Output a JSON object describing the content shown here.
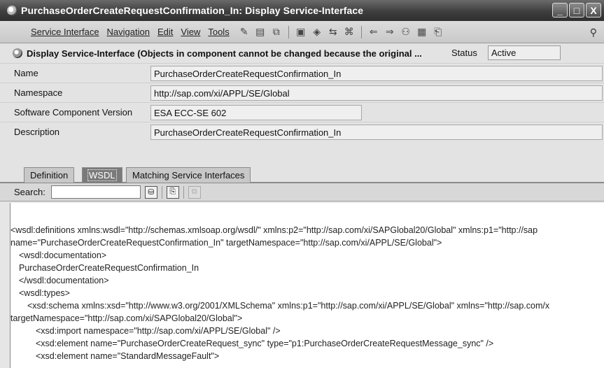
{
  "window": {
    "title": "PurchaseOrderCreateRequestConfirmation_In: Display Service-Interface",
    "minimize_label": "_",
    "maximize_label": "□",
    "close_label": "X"
  },
  "menu": [
    "Service Interface",
    "Navigation",
    "Edit",
    "View",
    "Tools"
  ],
  "toolbar_icons": {
    "group1": [
      "✎",
      "▤",
      "⧉"
    ],
    "group2": [
      "▣",
      "◈",
      "⇆",
      "⌘"
    ],
    "group3": [
      "⇐",
      "⇒",
      "⚇",
      "▦",
      "⎗"
    ],
    "pin": "⚲"
  },
  "header": {
    "title": "Display Service-Interface (Objects in component cannot be changed because the original ...",
    "status_label": "Status",
    "status_value": "Active"
  },
  "fields": [
    {
      "label": "Name",
      "value": "PurchaseOrderCreateRequestConfirmation_In"
    },
    {
      "label": "Namespace",
      "value": "http://sap.com/xi/APPL/SE/Global"
    },
    {
      "label": "Software Component Version",
      "value": "ESA ECC-SE 602"
    },
    {
      "label": "Description",
      "value": "PurchaseOrderCreateRequestConfirmation_In"
    }
  ],
  "tabs": [
    "Definition",
    "WSDL",
    "Matching Service Interfaces"
  ],
  "search": {
    "label": "Search:",
    "value": "",
    "btn_find": "⛁",
    "btn_next": "⎘",
    "btn_copy": "⧉"
  },
  "wsdl_lines": [
    "<wsdl:definitions xmlns:wsdl=\"http://schemas.xmlsoap.org/wsdl/\" xmlns:p2=\"http://sap.com/xi/SAPGlobal20/Global\" xmlns:p1=\"http://sap",
    "name=\"PurchaseOrderCreateRequestConfirmation_In\" targetNamespace=\"http://sap.com/xi/APPL/SE/Global\">",
    "<wsdl:documentation>",
    "PurchaseOrderCreateRequestConfirmation_In",
    "</wsdl:documentation>",
    "<wsdl:types>",
    "<xsd:schema xmlns:xsd=\"http://www.w3.org/2001/XMLSchema\" xmlns:p1=\"http://sap.com/xi/APPL/SE/Global\" xmlns=\"http://sap.com/x",
    "targetNamespace=\"http://sap.com/xi/SAPGlobal20/Global\">",
    "<xsd:import namespace=\"http://sap.com/xi/APPL/SE/Global\" />",
    "<xsd:element name=\"PurchaseOrderCreateRequest_sync\" type=\"p1:PurchaseOrderCreateRequestMessage_sync\" />",
    "<xsd:element name=\"StandardMessageFault\">"
  ]
}
